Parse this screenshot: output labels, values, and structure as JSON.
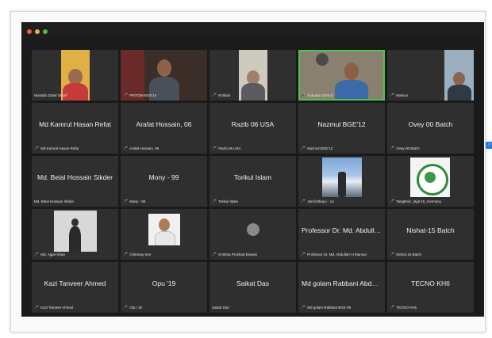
{
  "window": {
    "traffic_lights": [
      "red",
      "yellow",
      "green"
    ],
    "accent": "#4ec44b",
    "mute_color": "#e04040"
  },
  "participants": [
    {
      "label": "Mostafa Zahid Sharif",
      "center": ""
    },
    {
      "label": "PRITOM BGE'14",
      "center": ""
    },
    {
      "label": "M Bilah",
      "center": ""
    },
    {
      "label": "Subrata Guha D",
      "center": ""
    },
    {
      "label": "Mamun",
      "center": ""
    },
    {
      "label": "Md Kamrul Hasan Refat",
      "center": "Md Kamrul Hasan Refat"
    },
    {
      "label": "Arafat Hossain, 06",
      "center": "Arafat Hossain, 06"
    },
    {
      "label": "Razib 06 USA",
      "center": "Razib 06 USA"
    },
    {
      "label": "Nazmul BGE'12",
      "center": "Nazmul BGE'12"
    },
    {
      "label": "Ovey 00 Batch",
      "center": "Ovey 00 Batch"
    },
    {
      "label": "Md. Belal Hossain Sikder",
      "center": "Md. Belal Hossain Sikder"
    },
    {
      "label": "Mony - 99",
      "center": "Mony - 99"
    },
    {
      "label": "Torikul Islam",
      "center": "Torikul Islam"
    },
    {
      "label": "Jamil Bhuyo - 14",
      "center": ""
    },
    {
      "label": "Tanghirul _Bge'16_Germany",
      "center": ""
    },
    {
      "label": "Md. Ajgar Khan",
      "center": ""
    },
    {
      "label": "Chinmay Sen",
      "center": ""
    },
    {
      "label": "Krishna Proshad Biswas",
      "center": ""
    },
    {
      "label": "Professor Dr. Md. Abdullah Al Mamun",
      "center": "Professor Dr. Md. Abdulla..."
    },
    {
      "label": "Nishat 15 Batch",
      "center": "Nishat-15 Batch"
    },
    {
      "label": "Kazi Tanveer Ahmed",
      "center": "Kazi Tanveer Ahmed"
    },
    {
      "label": "Opu '19",
      "center": "Opu '19"
    },
    {
      "label": "Saikat Das",
      "center": "Saikat Das"
    },
    {
      "label": "Md golam Rabbani BGE 09",
      "center": "Md golam Rabbani Abdull..."
    },
    {
      "label": "TECNO KH6",
      "center": "TECNO KH6"
    }
  ]
}
